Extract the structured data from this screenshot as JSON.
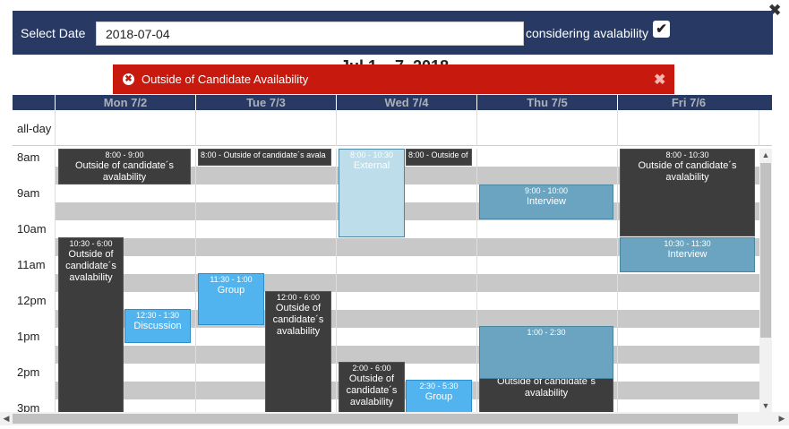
{
  "close_glyph": "✖",
  "topbar": {
    "select_date_label": "Select Date",
    "date_value": "2018-07-04",
    "considering_label": "considering avalability",
    "checkbox_checked": true,
    "checkbox_glyph": "✔"
  },
  "calendar_title": "Jul 1 – 7, 2018",
  "alert": {
    "icon_glyph": "✖",
    "message": "Outside of Candidate Availability",
    "close_glyph": "✖"
  },
  "days": [
    "Mon 7/2",
    "Tue 7/3",
    "Wed 7/4",
    "Thu 7/5",
    "Fri 7/6"
  ],
  "allday_label": "all-day",
  "time_labels": [
    "8am",
    "9am",
    "10am",
    "11am",
    "12pm",
    "1pm",
    "2pm",
    "3pm"
  ],
  "events": [
    {
      "time": "8:00 - 9:00",
      "title": "Outside of candidate´s avalability"
    },
    {
      "time": "8:00 - Outside of candidate´s avala",
      "title": ""
    },
    {
      "time": "8:00 - 10:30",
      "title": "External"
    },
    {
      "time": "8:00 - Outside of",
      "title": ""
    },
    {
      "time": "8:00 - 10:30",
      "title": "Outside of candidate´s avalability"
    },
    {
      "time": "9:00 - 10:00",
      "title": "Interview"
    },
    {
      "time": "10:30 - 6:00",
      "title": "Outside of candidate´s avalability"
    },
    {
      "time": "10:30 - 11:30",
      "title": "Interview"
    },
    {
      "time": "11:30 - 1:00",
      "title": "Group"
    },
    {
      "time": "12:00 - 6:00",
      "title": "Outside of candidate´s avalability"
    },
    {
      "time": "12:30 - 1:30",
      "title": "Discussion"
    },
    {
      "time": "1:00 - 2:30",
      "title": ""
    },
    {
      "time": "",
      "title": "Outside of candidate´s avalability"
    },
    {
      "time": "2:00 - 6:00",
      "title": "Outside of candidate´s avalability"
    },
    {
      "time": "2:30 - 5:30",
      "title": "Group"
    }
  ],
  "colors": {
    "header": "#283a63",
    "alert": "#c8190f",
    "dark_event": "#3d3d3d",
    "teal_event": "#6aa4c0",
    "light_event": "#bcdde9",
    "blue_event": "#52b4ee",
    "slot_stripe": "#c8c8c8"
  },
  "scroll": {
    "up": "▲",
    "down": "▼",
    "left": "◀",
    "right": "▶"
  }
}
